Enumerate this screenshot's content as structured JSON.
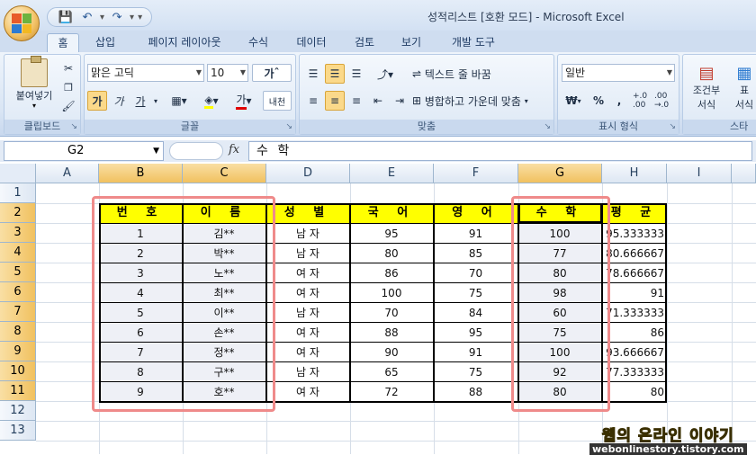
{
  "window": {
    "title": "성적리스트  [호환 모드] - Microsoft Excel"
  },
  "qat": {
    "save": "💾",
    "undo": "↶",
    "redo": "↷",
    "customize": "▾"
  },
  "tabs": [
    {
      "label": "홈"
    },
    {
      "label": "삽입"
    },
    {
      "label": "페이지 레이아웃"
    },
    {
      "label": "수식"
    },
    {
      "label": "데이터"
    },
    {
      "label": "검토"
    },
    {
      "label": "보기"
    },
    {
      "label": "개발 도구"
    }
  ],
  "ribbon": {
    "clipboard": {
      "label": "클립보드",
      "paste": "붙여넣기"
    },
    "font": {
      "label": "글꼴",
      "font_name": "맑은 고딕",
      "font_size": "10",
      "bold": "가",
      "italic": "가",
      "underline": "가",
      "grow": "가",
      "font_color_glyph": "가",
      "phonetic": "내천"
    },
    "alignment": {
      "label": "맞춤",
      "wrap": "텍스트 줄 바꿈",
      "merge": "병합하고 가운데 맞춤"
    },
    "number": {
      "label": "표시 형식",
      "format": "일반",
      "currency": "₩",
      "percent": "%",
      "comma": ",",
      "inc_decimal": "+.0 .00",
      "dec_decimal": ".00 →.0"
    },
    "styles": {
      "label": "스타",
      "conditional": "조건부",
      "conditional2": "서식",
      "table": "표",
      "table2": "서식"
    }
  },
  "formula_bar": {
    "cell_ref": "G2",
    "fx": "fx",
    "content": "수 학"
  },
  "sheet": {
    "columns": [
      "A",
      "B",
      "C",
      "D",
      "E",
      "F",
      "G",
      "H",
      "I"
    ],
    "rows": [
      "1",
      "2",
      "3",
      "4",
      "5",
      "6",
      "7",
      "8",
      "9",
      "10",
      "11",
      "12",
      "13"
    ],
    "headers": [
      "번 호",
      "이 름",
      "성 별",
      "국 어",
      "영 어",
      "수 학",
      "평 균"
    ],
    "data": [
      [
        "1",
        "김**",
        "남 자",
        "95",
        "91",
        "100",
        "95.333333"
      ],
      [
        "2",
        "박**",
        "남 자",
        "80",
        "85",
        "77",
        "80.666667"
      ],
      [
        "3",
        "노**",
        "여 자",
        "86",
        "70",
        "80",
        "78.666667"
      ],
      [
        "4",
        "최**",
        "여 자",
        "100",
        "75",
        "98",
        "91"
      ],
      [
        "5",
        "이**",
        "남 자",
        "70",
        "84",
        "60",
        "71.333333"
      ],
      [
        "6",
        "손**",
        "여 자",
        "88",
        "95",
        "75",
        "86"
      ],
      [
        "7",
        "정**",
        "여 자",
        "90",
        "91",
        "100",
        "93.666667"
      ],
      [
        "8",
        "구**",
        "남 자",
        "65",
        "75",
        "92",
        "77.333333"
      ],
      [
        "9",
        "호**",
        "여 자",
        "72",
        "88",
        "80",
        "80"
      ]
    ]
  },
  "watermark": {
    "title": "웹의 온라인 이야기",
    "url": "webonlinestory.tistory.com"
  }
}
